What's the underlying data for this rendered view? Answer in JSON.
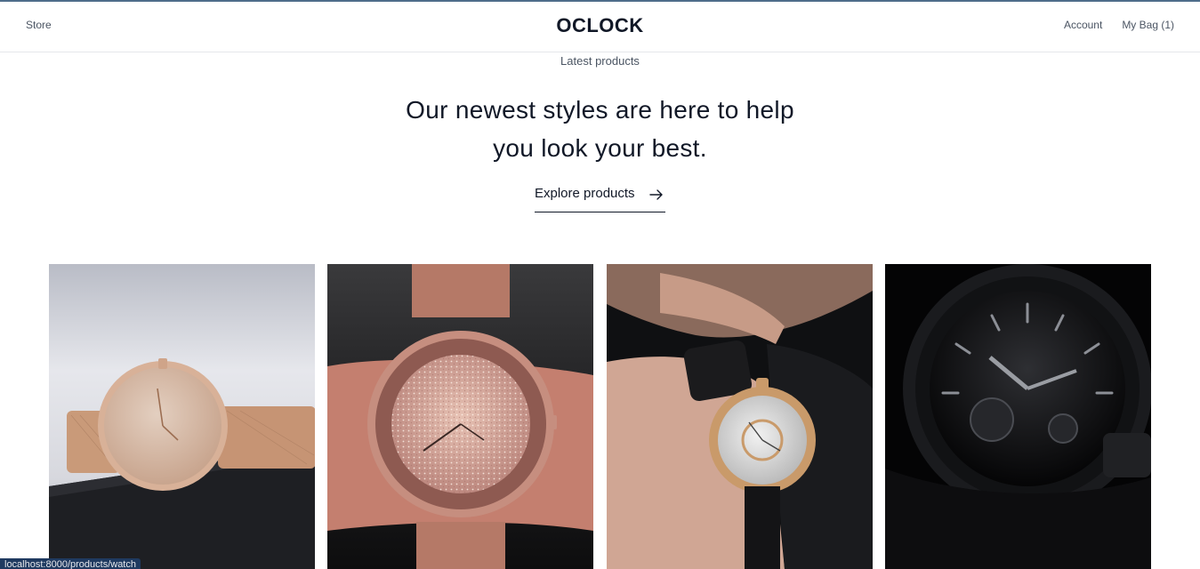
{
  "nav": {
    "store_label": "Store",
    "brand": "OCLOCK",
    "account_label": "Account",
    "bag_label": "My Bag (1)"
  },
  "hero": {
    "eyebrow": "Latest products",
    "headline_line1": "Our newest styles are here to help",
    "headline_line2": "you look your best.",
    "cta_label": "Explore products"
  },
  "products": [
    {
      "image": "rose-gold-mesh-watch-photo"
    },
    {
      "image": "rose-gold-glitter-watch-photo"
    },
    {
      "image": "gold-chronograph-on-wrist-photo"
    },
    {
      "image": "black-skeleton-watch-photo"
    }
  ],
  "statusbar": {
    "url": "localhost:8000/products/watch"
  },
  "colors": {
    "accent_topline": "#4f6d8a",
    "text": "#111827",
    "muted": "#4b5563"
  }
}
